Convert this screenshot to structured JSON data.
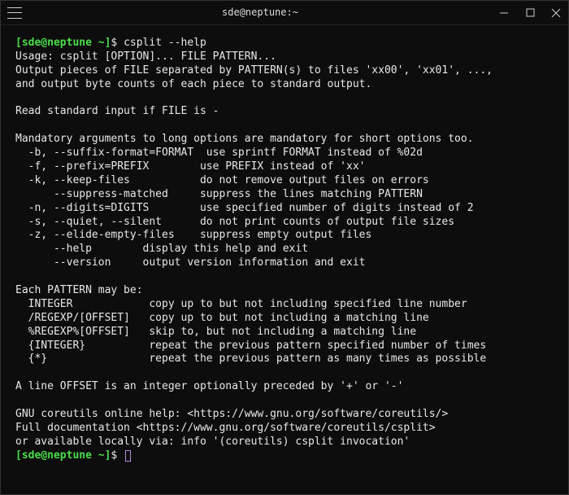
{
  "titlebar": {
    "title": "sde@neptune:~"
  },
  "prompt": {
    "user_host": "[sde@neptune",
    "path": "~]",
    "symbol": "$"
  },
  "command": "csplit --help",
  "output": [
    "Usage: csplit [OPTION]... FILE PATTERN...",
    "Output pieces of FILE separated by PATTERN(s) to files 'xx00', 'xx01', ...,",
    "and output byte counts of each piece to standard output.",
    "",
    "Read standard input if FILE is -",
    "",
    "Mandatory arguments to long options are mandatory for short options too.",
    "  -b, --suffix-format=FORMAT  use sprintf FORMAT instead of %02d",
    "  -f, --prefix=PREFIX        use PREFIX instead of 'xx'",
    "  -k, --keep-files           do not remove output files on errors",
    "      --suppress-matched     suppress the lines matching PATTERN",
    "  -n, --digits=DIGITS        use specified number of digits instead of 2",
    "  -s, --quiet, --silent      do not print counts of output file sizes",
    "  -z, --elide-empty-files    suppress empty output files",
    "      --help        display this help and exit",
    "      --version     output version information and exit",
    "",
    "Each PATTERN may be:",
    "  INTEGER            copy up to but not including specified line number",
    "  /REGEXP/[OFFSET]   copy up to but not including a matching line",
    "  %REGEXP%[OFFSET]   skip to, but not including a matching line",
    "  {INTEGER}          repeat the previous pattern specified number of times",
    "  {*}                repeat the previous pattern as many times as possible",
    "",
    "A line OFFSET is an integer optionally preceded by '+' or '-'",
    "",
    "GNU coreutils online help: <https://www.gnu.org/software/coreutils/>",
    "Full documentation <https://www.gnu.org/software/coreutils/csplit>",
    "or available locally via: info '(coreutils) csplit invocation'"
  ]
}
